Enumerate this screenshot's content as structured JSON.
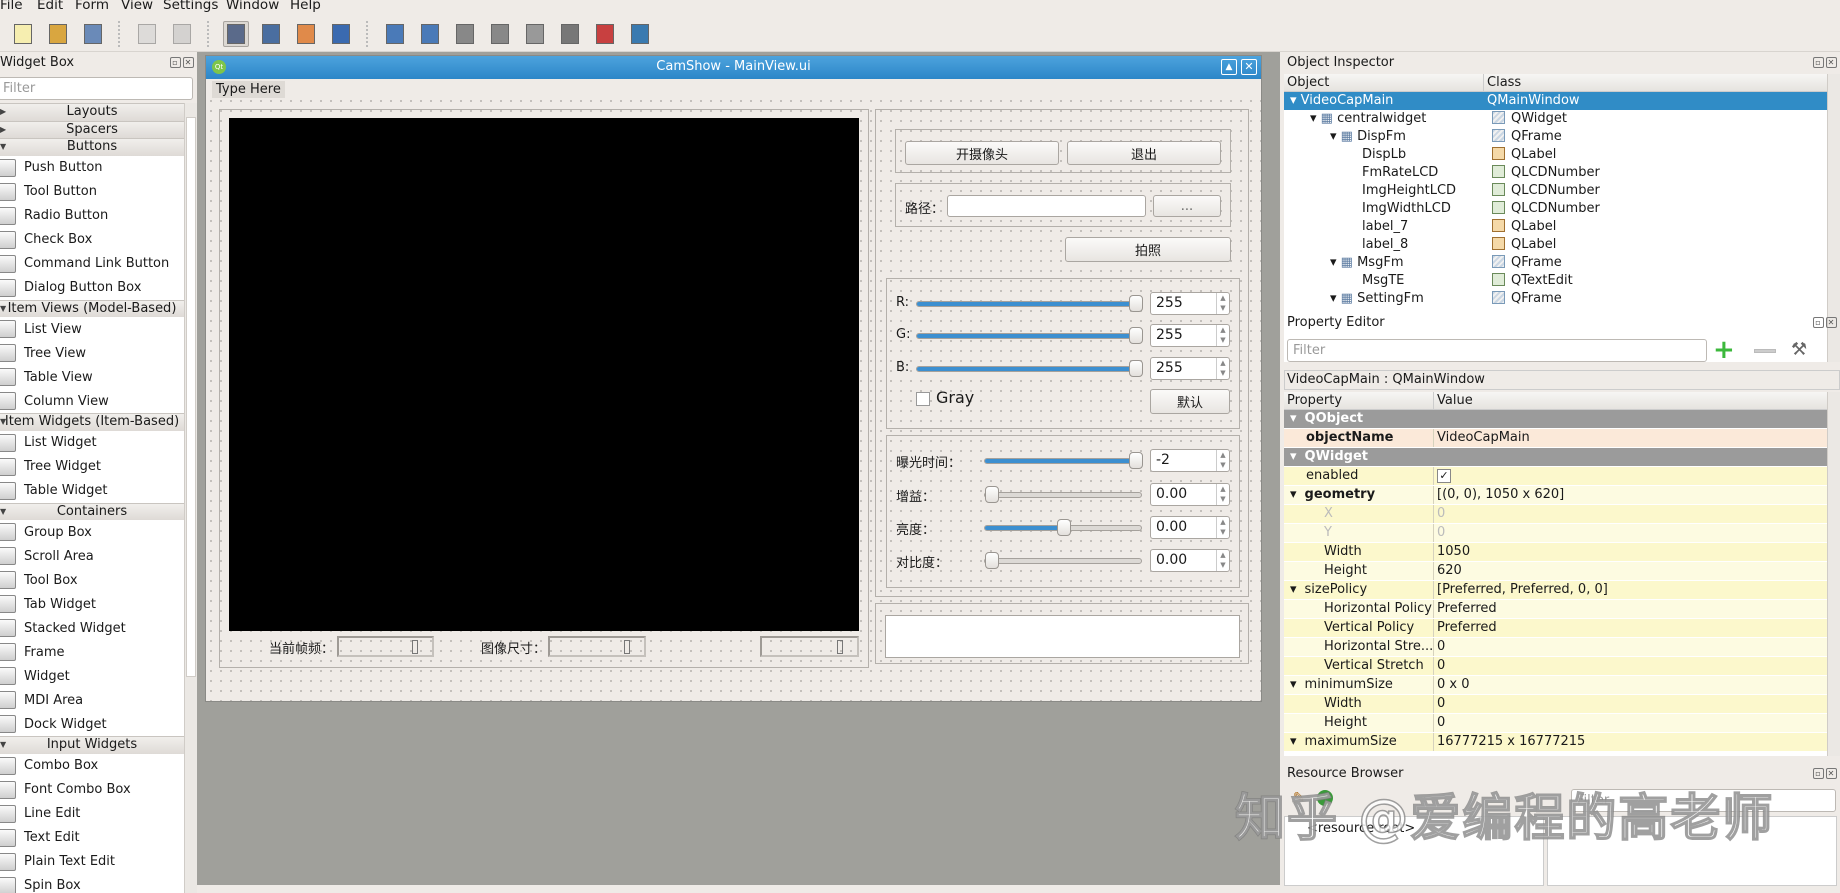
{
  "menubar": [
    "File",
    "Edit",
    "Form",
    "View",
    "Settings",
    "Window",
    "Help"
  ],
  "toolbar": [
    "new-file",
    "open-file",
    "save",
    "send-to-back",
    "bring-to-front",
    "edit-widgets",
    "edit-signals-slots",
    "edit-buddies",
    "edit-tab-order",
    "layout-horizontal",
    "layout-vertical",
    "layout-horizontal-splitter",
    "layout-vertical-splitter",
    "layout-grid",
    "layout-form",
    "break-layout",
    "adjust-size"
  ],
  "widget_box": {
    "title": "Widget Box",
    "filter_placeholder": "Filter",
    "sections": [
      {
        "label": "Layouts",
        "expanded": false,
        "items": []
      },
      {
        "label": "Spacers",
        "expanded": false,
        "items": []
      },
      {
        "label": "Buttons",
        "expanded": true,
        "items": [
          "Push Button",
          "Tool Button",
          "Radio Button",
          "Check Box",
          "Command Link Button",
          "Dialog Button Box"
        ]
      },
      {
        "label": "Item Views (Model-Based)",
        "expanded": true,
        "items": [
          "List View",
          "Tree View",
          "Table View",
          "Column View"
        ]
      },
      {
        "label": "Item Widgets (Item-Based)",
        "expanded": true,
        "items": [
          "List Widget",
          "Tree Widget",
          "Table Widget"
        ]
      },
      {
        "label": "Containers",
        "expanded": true,
        "items": [
          "Group Box",
          "Scroll Area",
          "Tool Box",
          "Tab Widget",
          "Stacked Widget",
          "Frame",
          "Widget",
          "MDI Area",
          "Dock Widget"
        ]
      },
      {
        "label": "Input Widgets",
        "expanded": true,
        "items": [
          "Combo Box",
          "Font Combo Box",
          "Line Edit",
          "Text Edit",
          "Plain Text Edit",
          "Spin Box"
        ]
      }
    ]
  },
  "form": {
    "title": "CamShow - MainView.ui",
    "menu_placeholder": "Type Here",
    "open_camera": "开摄像头",
    "exit": "退出",
    "path_label": "路径：",
    "path_value": "",
    "browse": "...",
    "capture": "拍照",
    "rgb": [
      {
        "label": "R:",
        "value": "255",
        "fraction": 1.0
      },
      {
        "label": "G:",
        "value": "255",
        "fraction": 1.0
      },
      {
        "label": "B:",
        "value": "255",
        "fraction": 1.0
      }
    ],
    "gray_label": "Gray",
    "gray_checked": false,
    "default_btn": "默认",
    "params": [
      {
        "label": "曝光时间：",
        "value": "-2",
        "fraction": 1.0
      },
      {
        "label": "增益：",
        "value": "0.00",
        "fraction": 0.0
      },
      {
        "label": "亮度：",
        "value": "0.00",
        "fraction": 0.5
      },
      {
        "label": "对比度：",
        "value": "0.00",
        "fraction": 0.0
      }
    ],
    "frame_rate_label": "当前帧频：",
    "image_size_label": "图像尺寸：",
    "lcd_values": [
      "0",
      "0",
      "0"
    ]
  },
  "object_inspector": {
    "title": "Object Inspector",
    "col_object": "Object",
    "col_class": "Class",
    "rows": [
      {
        "object": "VideoCapMain",
        "class": "QMainWindow",
        "depth": 0,
        "expander": true,
        "selected": true,
        "icon": "none"
      },
      {
        "object": "centralwidget",
        "class": "QWidget",
        "depth": 1,
        "expander": true,
        "icon": "widget"
      },
      {
        "object": "DispFm",
        "class": "QFrame",
        "depth": 2,
        "expander": true,
        "icon": "frame"
      },
      {
        "object": "DispLb",
        "class": "QLabel",
        "depth": 3,
        "icon": "label"
      },
      {
        "object": "FmRateLCD",
        "class": "QLCDNumber",
        "depth": 3,
        "icon": "lcd"
      },
      {
        "object": "ImgHeightLCD",
        "class": "QLCDNumber",
        "depth": 3,
        "icon": "lcd"
      },
      {
        "object": "ImgWidthLCD",
        "class": "QLCDNumber",
        "depth": 3,
        "icon": "lcd"
      },
      {
        "object": "label_7",
        "class": "QLabel",
        "depth": 3,
        "icon": "label"
      },
      {
        "object": "label_8",
        "class": "QLabel",
        "depth": 3,
        "icon": "label"
      },
      {
        "object": "MsgFm",
        "class": "QFrame",
        "depth": 2,
        "expander": true,
        "icon": "frame"
      },
      {
        "object": "MsgTE",
        "class": "QTextEdit",
        "depth": 3,
        "icon": "textedit"
      },
      {
        "object": "SettingFm",
        "class": "QFrame",
        "depth": 2,
        "expander": true,
        "icon": "frame"
      }
    ]
  },
  "property_editor": {
    "title": "Property Editor",
    "filter_placeholder": "Filter",
    "context": "VideoCapMain : QMainWindow",
    "col_property": "Property",
    "col_value": "Value",
    "rows": [
      {
        "name": "QObject",
        "value": "",
        "type": "group"
      },
      {
        "name": "objectName",
        "value": "VideoCapMain",
        "type": "bold",
        "bg": "#fbe9d9"
      },
      {
        "name": "QWidget",
        "value": "",
        "type": "group"
      },
      {
        "name": "enabled",
        "value": "✓",
        "type": "normal",
        "check": true
      },
      {
        "name": "geometry",
        "value": "[(0, 0), 1050 x 620]",
        "type": "bold",
        "expander": true
      },
      {
        "name": "X",
        "value": "0",
        "type": "sub",
        "disabled": true
      },
      {
        "name": "Y",
        "value": "0",
        "type": "sub",
        "disabled": true
      },
      {
        "name": "Width",
        "value": "1050",
        "type": "sub"
      },
      {
        "name": "Height",
        "value": "620",
        "type": "sub"
      },
      {
        "name": "sizePolicy",
        "value": "[Preferred, Preferred, 0, 0]",
        "type": "normal",
        "expander": true
      },
      {
        "name": "Horizontal Policy",
        "value": "Preferred",
        "type": "sub"
      },
      {
        "name": "Vertical Policy",
        "value": "Preferred",
        "type": "sub"
      },
      {
        "name": "Horizontal Stre...",
        "value": "0",
        "type": "sub"
      },
      {
        "name": "Vertical Stretch",
        "value": "0",
        "type": "sub"
      },
      {
        "name": "minimumSize",
        "value": "0 x 0",
        "type": "normal",
        "expander": true
      },
      {
        "name": "Width",
        "value": "0",
        "type": "sub"
      },
      {
        "name": "Height",
        "value": "0",
        "type": "sub"
      },
      {
        "name": "maximumSize",
        "value": "16777215 x 16777215",
        "type": "normal",
        "expander": true
      }
    ]
  },
  "resource_browser": {
    "title": "Resource Browser",
    "root": "<resource root>",
    "filter_placeholder": "Filter"
  },
  "watermark": "知乎 @爱编程的高老师",
  "colors": {
    "accent": "#308cc6",
    "titlebar": "#2c86c8",
    "mdi": "#a0a09b",
    "slider": "#3c8fd0"
  }
}
